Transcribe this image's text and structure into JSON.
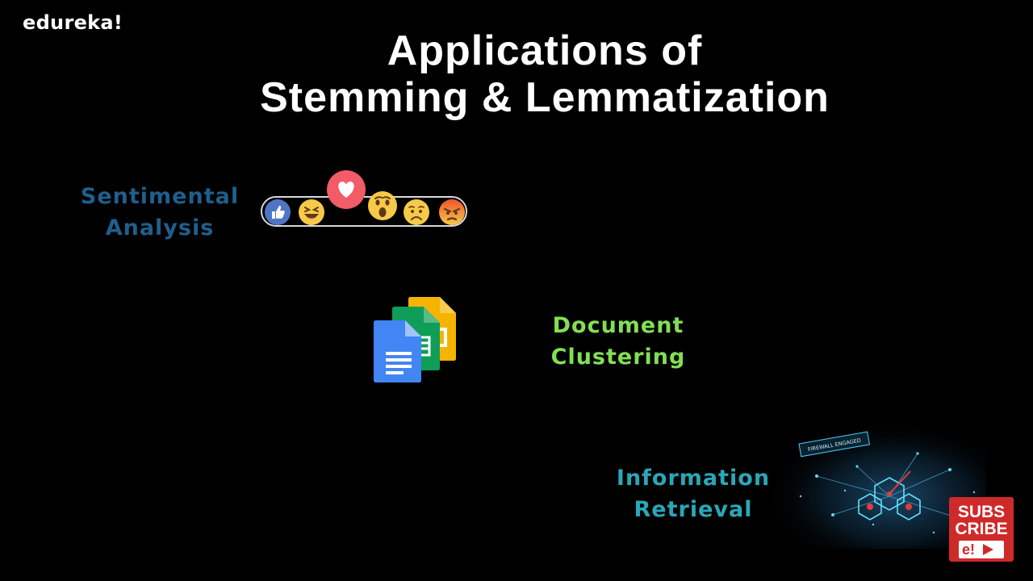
{
  "brand": {
    "logo": "edureka!"
  },
  "slide": {
    "title_line1": "Applications of",
    "title_line2": "Stemming & Lemmatization"
  },
  "applications": {
    "sentiment": {
      "line1": "Sentimental",
      "line2": "Analysis",
      "color": "#1f5f8c"
    },
    "clustering": {
      "line1": "Document",
      "line2": "Clustering",
      "color": "#82df54"
    },
    "retrieval": {
      "line1": "Information",
      "line2": "Retrieval",
      "color": "#2aa7b7"
    }
  },
  "reactions": [
    "like-icon",
    "laugh-icon",
    "love-icon",
    "wow-icon",
    "sad-icon",
    "angry-icon"
  ],
  "cyber_image": {
    "banner": "FIREWALL ENGAGED"
  },
  "subscribe": {
    "line1": "SUBS",
    "line2": "CRIBE",
    "badge": "e!"
  },
  "colors": {
    "background": "#000000",
    "subscribe_red": "#cf2a2a"
  }
}
